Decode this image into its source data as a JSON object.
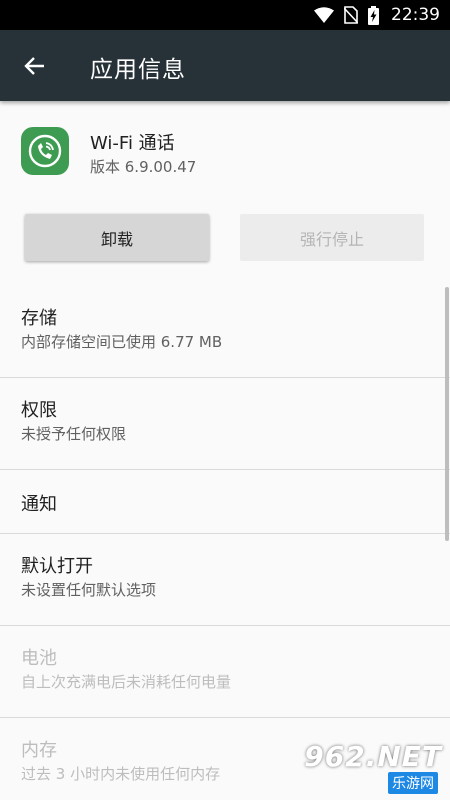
{
  "status_bar": {
    "time": "22:39",
    "icons": [
      "wifi-icon",
      "no-sim-icon",
      "battery-charging-icon"
    ]
  },
  "app_bar": {
    "title": "应用信息",
    "back_icon": "arrow-left-icon"
  },
  "app": {
    "name": "Wi-Fi 通话",
    "version": "版本 6.9.00.47",
    "icon": "wifi-call-icon",
    "icon_color": "#3e9b52"
  },
  "buttons": {
    "uninstall": "卸载",
    "force_stop": "强行停止"
  },
  "settings": [
    {
      "title": "存储",
      "subtitle": "内部存储空间已使用 6.77 MB",
      "enabled": true
    },
    {
      "title": "权限",
      "subtitle": "未授予任何权限",
      "enabled": true
    },
    {
      "title": "通知",
      "subtitle": "",
      "enabled": true
    },
    {
      "title": "默认打开",
      "subtitle": "未设置任何默认选项",
      "enabled": true
    },
    {
      "title": "电池",
      "subtitle": "自上次充满电后未消耗任何电量",
      "enabled": false
    },
    {
      "title": "内存",
      "subtitle": "过去 3 小时内未使用任何内存",
      "enabled": false
    }
  ],
  "watermark": {
    "text": "962.NET",
    "sub": "乐游网"
  },
  "colors": {
    "status_bar": "#000000",
    "app_bar": "#263238",
    "background": "#fafafa"
  }
}
